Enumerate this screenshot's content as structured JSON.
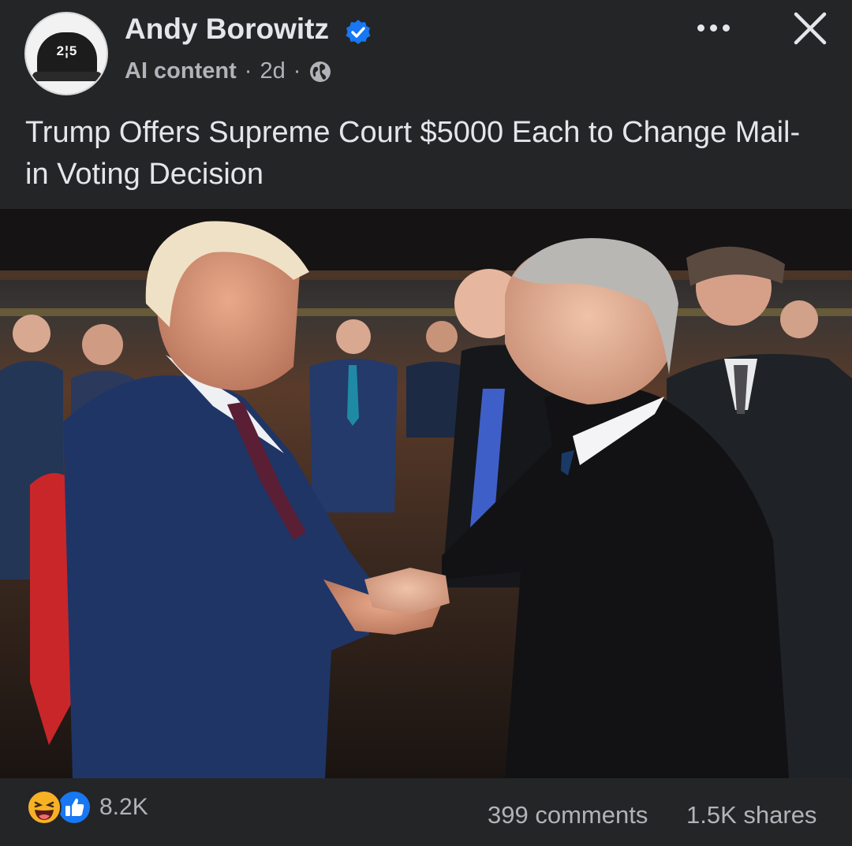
{
  "post": {
    "author": "Andy Borowitz",
    "avatar_text": "2¦5",
    "label": "AI content",
    "time": "2d",
    "separator": "·",
    "title": "Trump Offers Supreme Court $5000 Each to Change Mail-in Voting Decision"
  },
  "icons": {
    "verified": "verified-badge-icon",
    "audience": "globe-icon",
    "more": "more-options-icon",
    "close": "close-icon",
    "laugh": "haha-reaction-icon",
    "like": "like-reaction-icon"
  },
  "stats": {
    "reactions": "8.2K",
    "comments": "399 comments",
    "shares": "1.5K shares"
  },
  "colors": {
    "background": "#242526",
    "text": "#e4e6eb",
    "secondary": "#b0b3b8",
    "verified": "#1877f2",
    "like": "#1877f2",
    "laugh": "#f7b125"
  }
}
